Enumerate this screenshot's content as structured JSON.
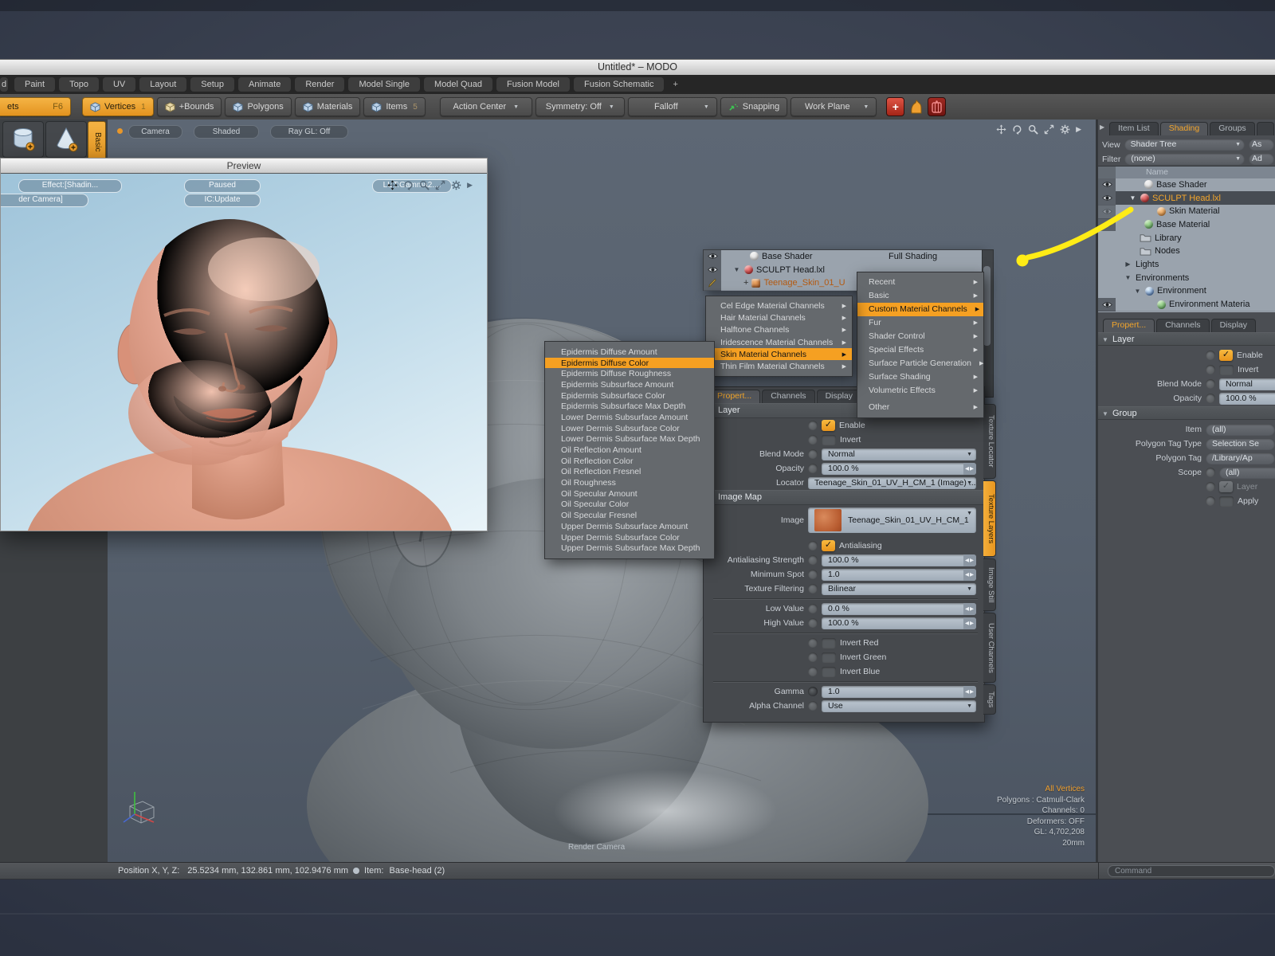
{
  "window": {
    "title": "Untitled* – MODO"
  },
  "tab_bar": {
    "fragment": "d",
    "tabs": [
      "Paint",
      "Topo",
      "UV",
      "Layout",
      "Setup",
      "Animate",
      "Render",
      "Model Single",
      "Model Quad",
      "Fusion Model",
      "Fusion Schematic",
      "+"
    ]
  },
  "toolbar": {
    "preset_fragment": "ets",
    "preset_key": "F6",
    "vertices": "Vertices",
    "vertices_badge": "1",
    "bounds": "+Bounds",
    "polygons": "Polygons",
    "materials": "Materials",
    "items": "Items",
    "items_badge": "5",
    "action_center": "Action Center",
    "symmetry": "Symmetry: Off",
    "falloff": "Falloff",
    "snapping": "Snapping",
    "work_plane": "Work Plane"
  },
  "left_tab": "Basic",
  "viewport": {
    "header": [
      "Camera",
      "Shaded",
      "Ray GL: Off"
    ],
    "camera_label": "Render Camera",
    "stats": {
      "sel": "All Vertices",
      "polygons": "Polygons : Catmull-Clark",
      "channels": "Channels: 0",
      "deformers": "Deformers: OFF",
      "gl": "GL: 4,702,208",
      "focal": "20mm"
    }
  },
  "preview": {
    "title": "Preview",
    "buttons_row1": [
      "Effect:[Shadin...",
      "Paused",
      "LUT:Gamma2...."
    ],
    "buttons_row2": [
      "der Camera]",
      "IC:Update"
    ]
  },
  "mini_tree": {
    "rows": [
      "Base Shader",
      "SCULPT Head.lxl",
      "Teenage_Skin_01_U"
    ],
    "shading_col": "Full Shading",
    "plus": "+"
  },
  "menu_categories1": {
    "items": [
      "Recent",
      "Basic",
      "Custom Material Channels",
      "Fur",
      "Shader Control",
      "Special Effects",
      "Surface Particle Generation",
      "Surface Shading",
      "Volumetric Effects",
      "Other"
    ],
    "highlight": "Custom Material Channels"
  },
  "menu_categories2": {
    "items": [
      "Cel Edge Material Channels",
      "Hair Material Channels",
      "Halftone Channels",
      "Iridescence Material Channels",
      "Skin Material Channels",
      "Thin Film Material Channels"
    ],
    "highlight": "Skin Material Channels"
  },
  "submenu": {
    "items": [
      "Epidermis Diffuse Amount",
      "Epidermis Diffuse Color",
      "Epidermis Diffuse Roughness",
      "Epidermis Subsurface Amount",
      "Epidermis Subsurface Color",
      "Epidermis Subsurface Max Depth",
      "Lower Dermis Subsurface Amount",
      "Lower Dermis Subsurface Color",
      "Lower Dermis Subsurface Max Depth",
      "Oil Reflection Amount",
      "Oil Reflection Color",
      "Oil Reflection Fresnel",
      "Oil Roughness",
      "Oil Specular Amount",
      "Oil Specular Color",
      "Oil Specular Fresnel",
      "Upper Dermis Subsurface Amount",
      "Upper Dermis Subsurface Color",
      "Upper Dermis Subsurface Max Depth"
    ],
    "highlight": "Epidermis Diffuse Color"
  },
  "layer_panel": {
    "tabs": [
      "Propert...",
      "Channels",
      "Display"
    ],
    "layer_header": "Layer",
    "enable": "Enable",
    "invert": "Invert",
    "blend_label": "Blend Mode",
    "blend_value": "Normal",
    "opacity_label": "Opacity",
    "opacity_value": "100.0 %",
    "locator_label": "Locator",
    "locator_value": "Teenage_Skin_01_UV_H_CM_1 (Image) ...",
    "image_map_header": "Image Map",
    "image_label": "Image",
    "image_value": "Teenage_Skin_01_UV_H_CM_1",
    "antialiasing": "Antialiasing",
    "aa_strength_label": "Antialiasing Strength",
    "aa_strength_value": "100.0 %",
    "min_spot_label": "Minimum Spot",
    "min_spot_value": "1.0",
    "tex_filter_label": "Texture Filtering",
    "tex_filter_value": "Bilinear",
    "low_label": "Low Value",
    "low_value": "0.0 %",
    "high_label": "High Value",
    "high_value": "100.0 %",
    "invert_red": "Invert Red",
    "invert_green": "Invert Green",
    "invert_blue": "Invert Blue",
    "gamma_label": "Gamma",
    "gamma_value": "1.0",
    "alpha_label": "Alpha Channel",
    "alpha_value": "Use",
    "side_tabs": [
      "Texture Locator",
      "Texture Layers",
      "Image Still",
      "User Channels",
      "Tags"
    ]
  },
  "sidebar": {
    "tabs": [
      "Item List",
      "Shading",
      "Groups"
    ],
    "view_label": "View",
    "view_value": "Shader Tree",
    "view_extra": "As",
    "filter_label": "Filter",
    "filter_value": "(none)",
    "filter_extra": "Ad",
    "name_header": "Name",
    "tree": [
      {
        "label": "Base Shader"
      },
      {
        "label": "SCULPT Head.lxl"
      },
      {
        "label": "Skin Material"
      },
      {
        "label": "Base Material"
      },
      {
        "label": "Library"
      },
      {
        "label": "Nodes"
      },
      {
        "label": "Lights"
      },
      {
        "label": "Environments"
      },
      {
        "label": "Environment"
      },
      {
        "label": "Environment Materia"
      }
    ],
    "props": {
      "tabs": [
        "Propert...",
        "Channels",
        "Display"
      ],
      "layer_header": "Layer",
      "enable": "Enable",
      "invert": "Invert",
      "blend_label": "Blend Mode",
      "blend_value": "Normal",
      "opacity_label": "Opacity",
      "opacity_value": "100.0 %",
      "group_header": "Group",
      "item_label": "Item",
      "item_value": "(all)",
      "ptt_label": "Polygon Tag Type",
      "ptt_value": "Selection Se",
      "pt_label": "Polygon Tag",
      "pt_value": "/Library/Ap",
      "scope_label": "Scope",
      "scope_value": "(all)",
      "layer_toggle": "Layer",
      "apply_toggle": "Apply"
    }
  },
  "status_bar": {
    "position_label": "Position X, Y, Z:",
    "position_value": "25.5234 mm, 132.861 mm, 102.9476 mm",
    "item_label": "Item:",
    "item_value": "Base-head (2)",
    "command": "Command"
  },
  "colors": {
    "accent_orange": "#f5a022",
    "tree_selected_text": "#f2a52c",
    "annotation_yellow": "#ffec16",
    "field_blue_gray": "#aab6c2",
    "viewport_bg": "#57616e"
  }
}
